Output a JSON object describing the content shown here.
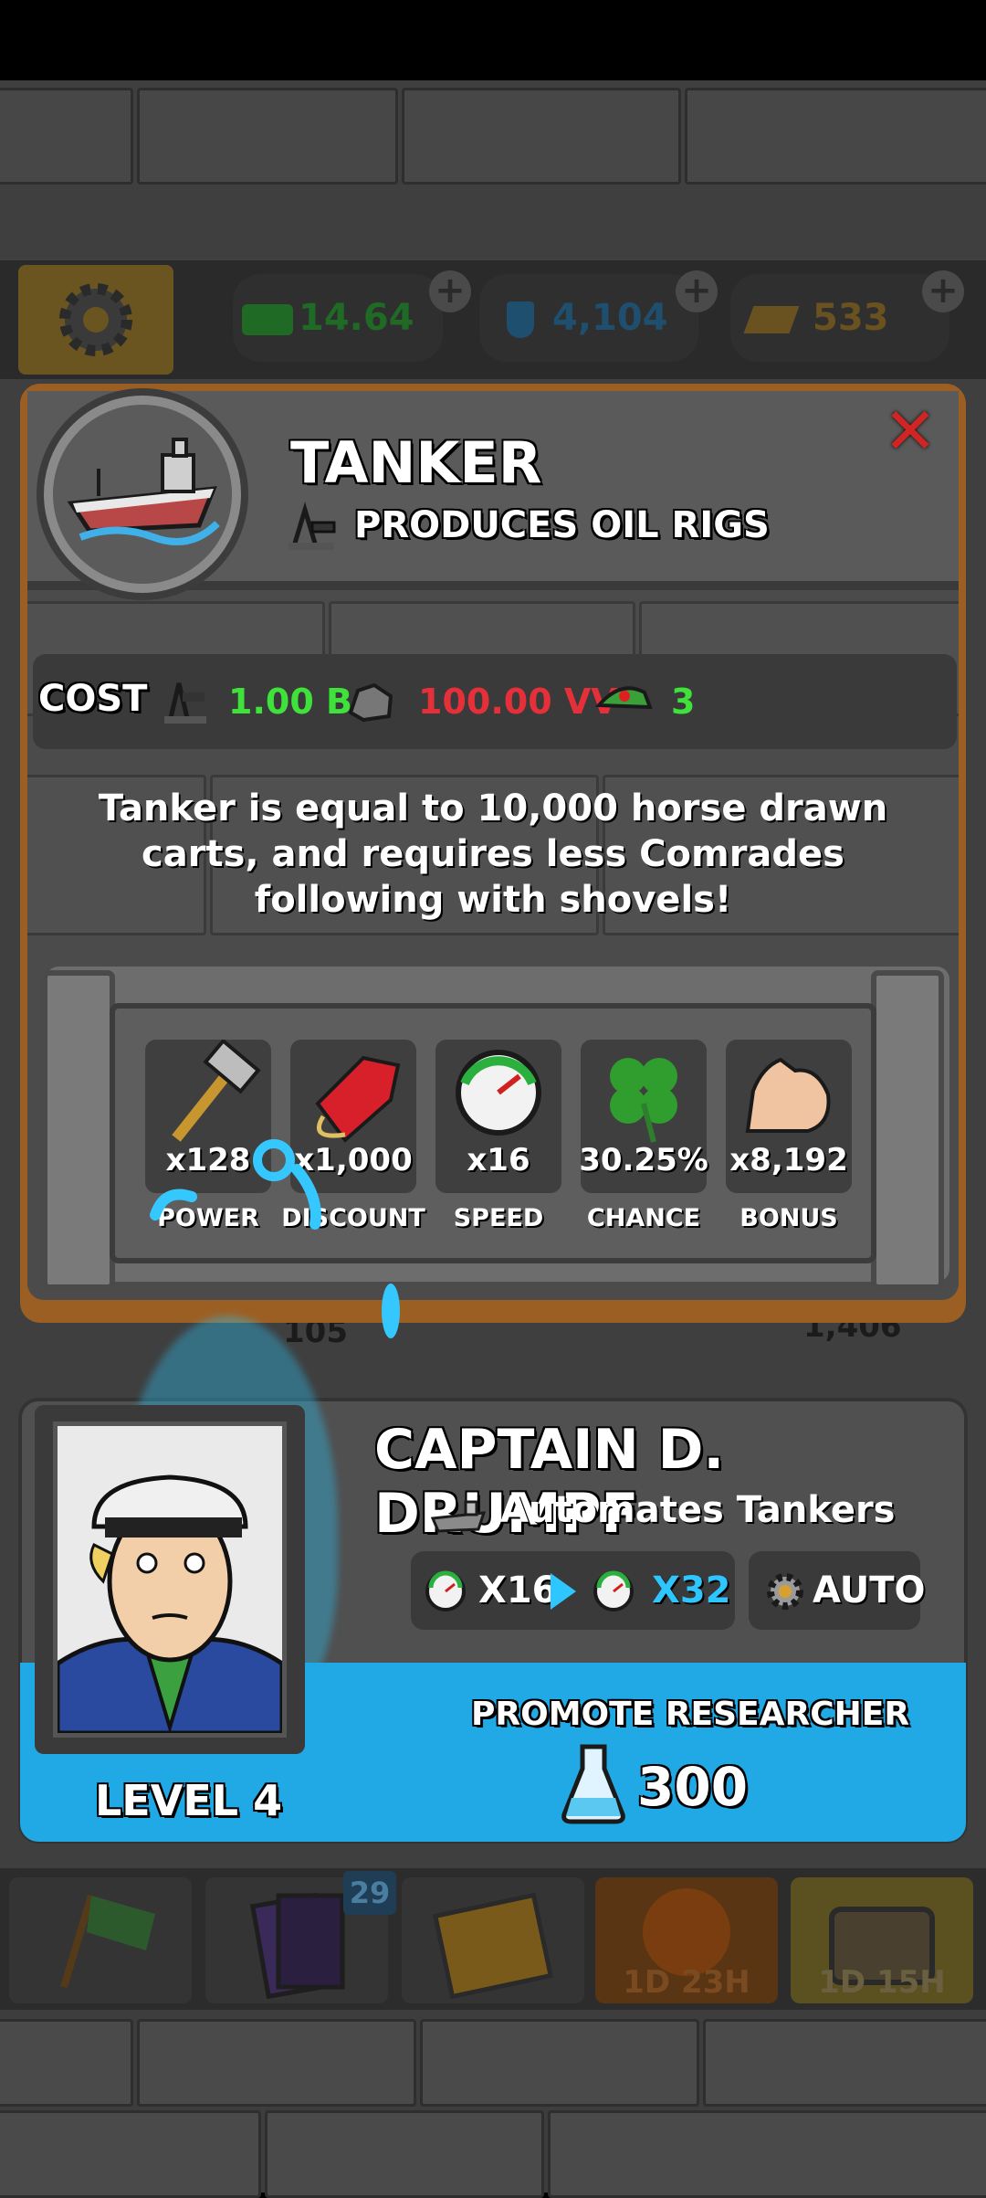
{
  "top_resources": {
    "money": "14.64 M",
    "research": "4,104",
    "gold": "533"
  },
  "info_panel": {
    "title": "TANKER",
    "subtitle": "PRODUCES OIL RIGS",
    "cost_label": "COST",
    "cost_oil": "1.00 B",
    "cost_ore": "100.00 VV",
    "cost_comrades": "3",
    "description": "Tanker is equal to 10,000 horse drawn carts, and requires less Comrades following with shovels!",
    "stats": [
      {
        "value": "x128",
        "label": "POWER",
        "icon": "hammer-icon"
      },
      {
        "value": "x1,000",
        "label": "DISCOUNT",
        "icon": "price-tag-icon"
      },
      {
        "value": "x16",
        "label": "SPEED",
        "icon": "speedometer-icon"
      },
      {
        "value": "30.25%",
        "label": "CHANCE",
        "icon": "clover-icon"
      },
      {
        "value": "x8,192",
        "label": "BONUS",
        "icon": "muscle-icon"
      }
    ],
    "colors": {
      "cost_oil": "#3fe23a",
      "cost_ore": "#e5303a",
      "cost_comrades": "#3fe23a",
      "close": "#d32424"
    }
  },
  "background_labels": {
    "left": "105",
    "right": "1,406"
  },
  "researcher": {
    "name": "CAPTAIN D. DRUMPF",
    "automates": "Automates Tankers",
    "speed_from": "X16",
    "speed_to": "X32",
    "auto_label": "AUTO",
    "level": "LEVEL 4",
    "promote_label": "PROMOTE RESEARCHER",
    "promote_cost": "300",
    "colors": {
      "speed_to": "#2ec6ff",
      "promote_bg": "#21a9e6"
    }
  },
  "bottom_nav": {
    "cards_badge": "29",
    "timer1": "1D 23H",
    "timer2": "1D 15H"
  }
}
